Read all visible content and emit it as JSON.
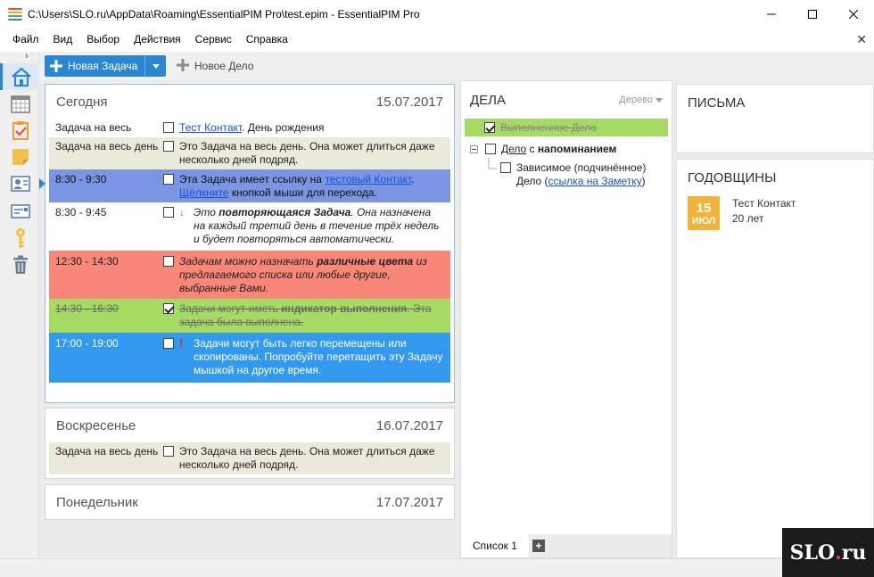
{
  "window": {
    "title": "C:\\Users\\SLO.ru\\AppData\\Roaming\\EssentialPIM Pro\\test.epim - EssentialPIM Pro",
    "app_icon_colors": [
      "#e84c3d",
      "#f5a623",
      "#4caf50",
      "#2b87cf"
    ],
    "controls": {
      "minimize": "minimize-icon",
      "maximize": "maximize-icon",
      "close": "close-icon"
    }
  },
  "menu": {
    "items": [
      "Файл",
      "Вид",
      "Выбор",
      "Действия",
      "Сервис",
      "Справка"
    ],
    "close_glyph": "✕"
  },
  "toolbar": {
    "new_task_label": "Новая Задача",
    "new_case_label": "Новое Дело"
  },
  "sidebar": {
    "collapse_glyph": "›",
    "icons": [
      "home-icon",
      "calendar-icon",
      "tasks-icon",
      "notes-icon",
      "contacts-icon",
      "mail-icon",
      "key-icon",
      "trash-icon"
    ]
  },
  "today": {
    "title": "Сегодня",
    "date": "15.07.2017",
    "tasks": [
      {
        "time": "Задача на весь",
        "text_link": "Тест Контакт",
        "text_after": ". День рождения"
      },
      {
        "time": "Задача на весь день",
        "text": "Это Задача на весь день. Она может длиться даже несколько дней подряд."
      },
      {
        "time": "8:30 - 9:30",
        "text_before": "Эта Задача имеет ссылку на ",
        "link1": "тестовый Контакт",
        "text_mid": ". ",
        "link2": "Щёлкните",
        "text_after": " кнопкой мыши для перехода."
      },
      {
        "time": "8:30 - 9:45",
        "indicator": "↓",
        "t1": "Это ",
        "bold": "повторяющаяся Задача",
        "t2": ". Она назначена на каждый третий день в течение трёх недель и будет повторяться автоматически."
      },
      {
        "time": "12:30 - 14:30",
        "t1": "Задачам можно назначать ",
        "bold": "различные цвета",
        "t2": " из предлагаемого списка или любые другие, выбранные Вами."
      },
      {
        "time": "14:30 - 16:30",
        "t1": "Задачи могут иметь ",
        "bold": "индикатор выполнения",
        "t2": ". Эта задача была выполнена."
      },
      {
        "time": "17:00 - 19:00",
        "indicator": "!",
        "text": "Задачи могут быть легко перемещены или скопированы. Попробуйте перетащить эту Задачу мышкой на другое время."
      }
    ]
  },
  "sunday": {
    "title": "Воскресенье",
    "date": "16.07.2017",
    "task_time": "Задача на весь день",
    "task_text": "Это Задача на весь день. Она может длиться даже несколько дней подряд."
  },
  "monday": {
    "title": "Понедельник",
    "date": "17.07.2017"
  },
  "colors": {
    "accent": "#2b87cf",
    "allday": "#e9e9dc",
    "blue_task": "#7b95e3",
    "red_task": "#f8877a",
    "green_task": "#a5da63",
    "bright_blue_task": "#3399ee",
    "green_arrow": "#2ea33e",
    "red_excl": "#e02020",
    "badge": "#f3b33b"
  },
  "todo": {
    "title": "ДЕЛА",
    "view_label": "Дерево",
    "done_item": "Выполненное Дело",
    "reminder_link": "Дело",
    "reminder_mid": " с ",
    "reminder_bold": "напоминанием",
    "child_text": "Зависимое (подчинённое) Дело (",
    "child_link": "ссылка на Заметку",
    "child_end": ")",
    "tab_label": "Список 1",
    "tab_add": "+"
  },
  "mail": {
    "title": "ПИСЬМА"
  },
  "anniversaries": {
    "title": "ГОДОВЩИНЫ",
    "day": "15",
    "month": "ИЮЛ",
    "name": "Тест Контакт",
    "years": "20 лет"
  },
  "watermark": {
    "prefix": "SLO",
    "dot": ".",
    "suffix": "ru"
  }
}
